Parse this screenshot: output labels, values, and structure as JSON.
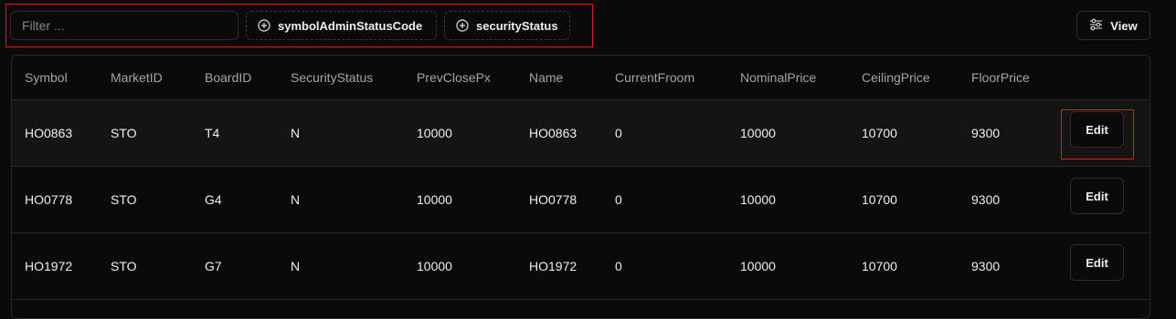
{
  "filter": {
    "placeholder": "Filter ...",
    "value": ""
  },
  "chips": [
    {
      "label": "symbolAdminStatusCode",
      "icon": "plus-circle-icon"
    },
    {
      "label": "securityStatus",
      "icon": "plus-circle-icon"
    }
  ],
  "view_button": {
    "label": "View",
    "icon": "sliders-icon"
  },
  "table": {
    "columns": [
      "Symbol",
      "MarketID",
      "BoardID",
      "SecurityStatus",
      "PrevClosePx",
      "Name",
      "CurrentFroom",
      "NominalPrice",
      "CeilingPrice",
      "FloorPrice"
    ],
    "rows": [
      [
        "HO0863",
        "STO",
        "T4",
        "N",
        "10000",
        "HO0863",
        "0",
        "10000",
        "10700",
        "9300"
      ],
      [
        "HO0778",
        "STO",
        "G4",
        "N",
        "10000",
        "HO0778",
        "0",
        "10000",
        "10700",
        "9300"
      ],
      [
        "HO1972",
        "STO",
        "G7",
        "N",
        "10000",
        "HO1972",
        "0",
        "10000",
        "10700",
        "9300"
      ]
    ],
    "row_action_label": "Edit"
  },
  "colors": {
    "background": "#0b0a0a",
    "highlight": "#d21f2a",
    "border": "#2a2827"
  }
}
